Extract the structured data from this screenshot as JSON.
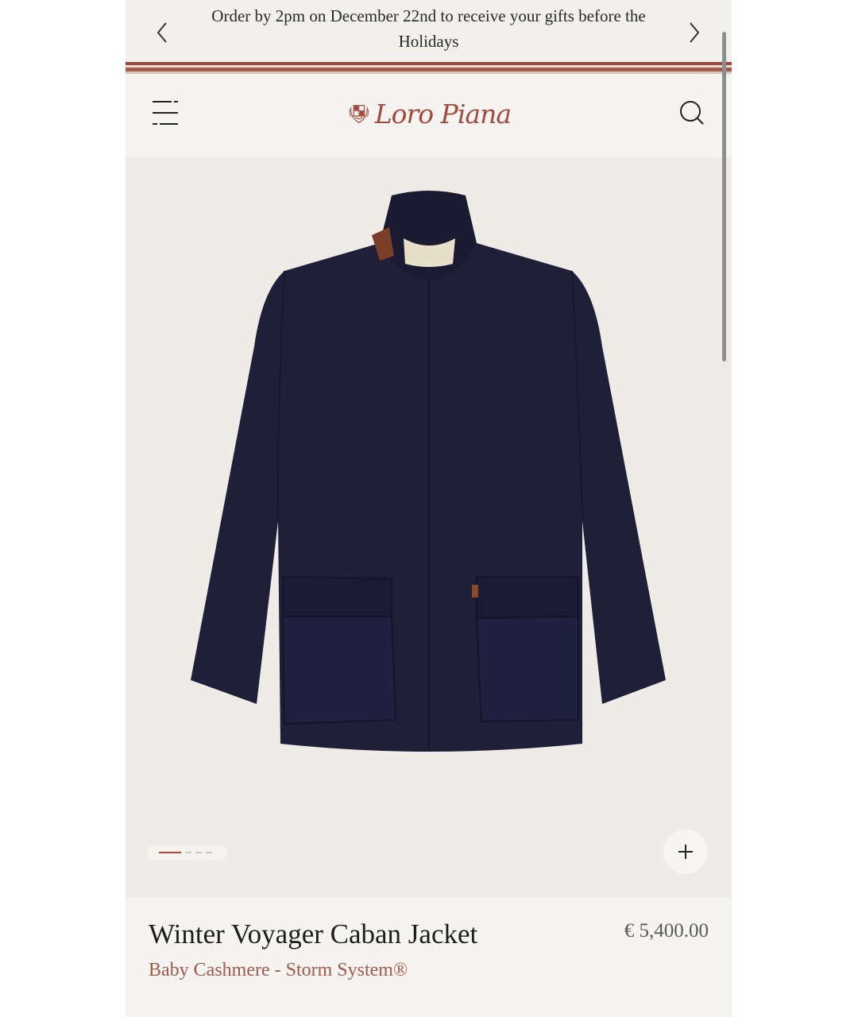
{
  "promo_bar": {
    "message": "Order by 2pm on December 22nd to receive your gifts before the Holidays",
    "prev_icon": "chevron-left-icon",
    "next_icon": "chevron-right-icon"
  },
  "header": {
    "brand": "Loro Piana",
    "menu_icon": "hamburger-menu-icon",
    "search_icon": "search-icon"
  },
  "gallery": {
    "image_alt": "Winter Voyager Caban Jacket",
    "current_slide": 1,
    "total_slides": 4,
    "zoom_icon": "plus-icon"
  },
  "product": {
    "name": "Winter Voyager Caban Jacket",
    "price": "€ 5,400.00",
    "material": "Baby Cashmere - Storm System®"
  },
  "colors": {
    "accent": "#a24a3c",
    "background": "#f4f2ee",
    "coat": "#1f1f3a"
  }
}
